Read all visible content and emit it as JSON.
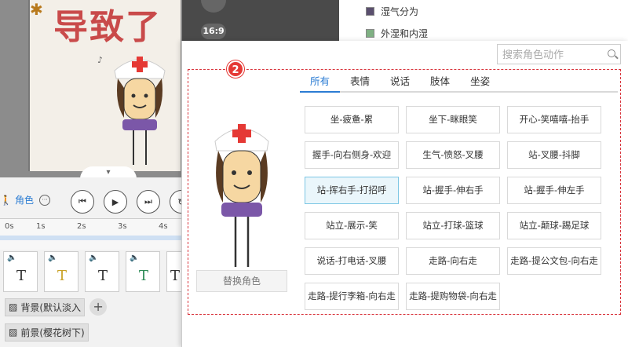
{
  "canvas": {
    "title": "导致了",
    "aspect_ratio": "16:9"
  },
  "legend": [
    {
      "label": "湿气分为",
      "color": "#5a4f6e"
    },
    {
      "label": "外湿和内湿",
      "color": "#7fb083"
    }
  ],
  "controls": {
    "role_tab": "角色",
    "more_label": "···",
    "ruler": [
      "0s",
      "1s",
      "2s",
      "3s",
      "4s"
    ],
    "tracks": [
      "T",
      "T",
      "T",
      "T",
      "T"
    ]
  },
  "layers": {
    "background": "背景(默认淡入",
    "foreground": "前景(樱花树下)"
  },
  "popup": {
    "search_placeholder": "搜索角色动作",
    "badge": "2",
    "tabs": [
      "所有",
      "表情",
      "说话",
      "肢体",
      "坐姿"
    ],
    "active_tab": 0,
    "replace_label": "替换角色",
    "actions": [
      "坐-疲惫-累",
      "坐下-眯眼笑",
      "开心-笑嘻嘻-抬手",
      "握手-向右侧身-欢迎",
      "生气-愤怒-叉腰",
      "站-叉腰-抖脚",
      "站-挥右手-打招呼",
      "站-握手-伸右手",
      "站-握手-伸左手",
      "站立-展示-笑",
      "站立-打球-篮球",
      "站立-颠球-踢足球",
      "说话-打电话-叉腰",
      "走路-向右走",
      "走路-提公文包-向右走",
      "走路-提行李箱-向右走",
      "走路-提购物袋-向右走"
    ],
    "selected_action": 6
  },
  "colors": {
    "accent": "#2b7cd3",
    "dashed_border": "#d9363e",
    "badge": "#e53935"
  }
}
